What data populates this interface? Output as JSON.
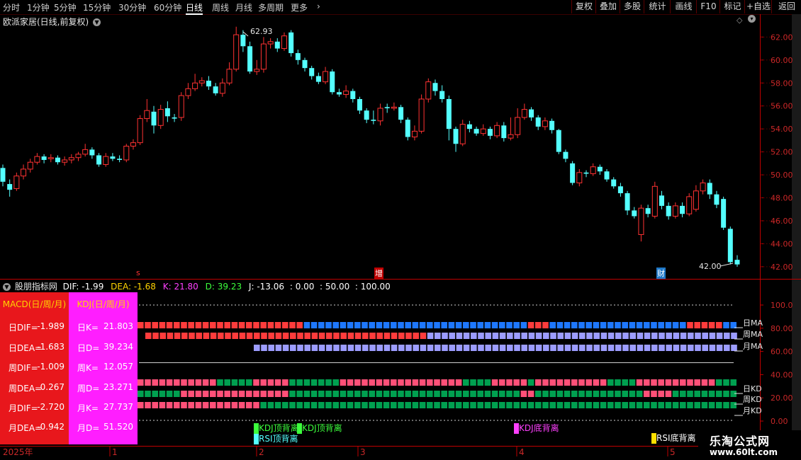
{
  "toolbar": {
    "periods": [
      "分时",
      "1分钟",
      "5分钟",
      "15分钟",
      "30分钟",
      "60分钟",
      "日线",
      "周线",
      "月线",
      "多周期",
      "更多"
    ],
    "active_period": "日线",
    "right_buttons": [
      "复权",
      "叠加",
      "多股",
      "统计",
      "画线",
      "F10",
      "标记",
      "+自选",
      "返回"
    ]
  },
  "chart_title": "欧派家居(日线,前复权)",
  "indicator_header": {
    "name": "股朋指标网",
    "dif_label": "DIF: -1.99",
    "dea_label": "DEA: -1.68",
    "k_label": "K: 21.80",
    "d_label": "D: 39.23",
    "j_label": "J: -13.06",
    "extra_label": ": 0.00  : 50.00  : 100.00"
  },
  "markers": {
    "s": "s",
    "zeng": "增",
    "cai": "财"
  },
  "colors": {
    "up": "#ff3232",
    "down": "#54ffff",
    "blue_block": "#1e78ff",
    "lavender_block": "#9c9cff",
    "green_block": "#00a050",
    "pink_block": "#ff5078",
    "axis": "#c00000"
  },
  "price_panel": {
    "high_label": "62.93",
    "low_label": "42.00",
    "y_ticks": [
      "62.00",
      "60.00",
      "58.00",
      "56.00",
      "54.00",
      "52.00",
      "50.00",
      "48.00",
      "46.00",
      "44.00",
      "42.00"
    ]
  },
  "indicator_panel": {
    "y_ticks": [
      "100.0",
      "80.00",
      "60.00",
      "40.00",
      "20.00",
      "0.00"
    ],
    "macd_row_labels": [
      "日MA",
      "周MA",
      "月MA"
    ],
    "kdj_row_labels": [
      "日KD",
      "周KD",
      "月KD"
    ]
  },
  "signals": {
    "kdj_top_1": "KDJ顶背离",
    "kdj_top_2": "KDJ顶背离",
    "rsi_top": "RSI顶背离",
    "kdj_bottom": "KDJ底背离",
    "rsi_bottom": "RSI底背离"
  },
  "left_panel": {
    "macd_header": "MACD(日/周/月)",
    "kdj_header": "KDJ(日/周/月)",
    "macd_rows": [
      {
        "k": "日DIF=",
        "v": "-1.989"
      },
      {
        "k": "日DEA=",
        "v": "-1.683"
      },
      {
        "k": "周DIF=",
        "v": "-1.009"
      },
      {
        "k": "周DEA=",
        "v": "0.267"
      },
      {
        "k": "月DIF=",
        "v": "-2.720"
      },
      {
        "k": "月DEA=",
        "v": "-0.942"
      }
    ],
    "kdj_rows": [
      {
        "k": "日K=",
        "v": "21.803"
      },
      {
        "k": "日D=",
        "v": "39.234"
      },
      {
        "k": "周K=",
        "v": "12.057"
      },
      {
        "k": "周D=",
        "v": "23.271"
      },
      {
        "k": "月K=",
        "v": "27.737"
      },
      {
        "k": "月D=",
        "v": "51.520"
      }
    ]
  },
  "time_axis": {
    "year_label": "2025年",
    "months": [
      "1",
      "2",
      "3",
      "4",
      "5"
    ]
  },
  "logo": {
    "line1": "乐淘公式网",
    "line2": "www.60lt.com"
  },
  "chart_data": {
    "type": "candlestick",
    "ylim": [
      41.5,
      63.5
    ],
    "candles": [
      {
        "o": 50.6,
        "c": 49.4,
        "h": 50.9,
        "l": 49.0
      },
      {
        "o": 49.2,
        "c": 48.7,
        "h": 49.6,
        "l": 48.1
      },
      {
        "o": 48.8,
        "c": 49.9,
        "h": 50.2,
        "l": 48.6
      },
      {
        "o": 49.9,
        "c": 50.5,
        "h": 50.9,
        "l": 49.6
      },
      {
        "o": 50.5,
        "c": 51.1,
        "h": 51.4,
        "l": 50.2
      },
      {
        "o": 51.1,
        "c": 51.6,
        "h": 51.9,
        "l": 50.9
      },
      {
        "o": 51.6,
        "c": 51.3,
        "h": 51.8,
        "l": 51.0
      },
      {
        "o": 51.4,
        "c": 51.5,
        "h": 51.8,
        "l": 51.1
      },
      {
        "o": 51.5,
        "c": 51.1,
        "h": 51.7,
        "l": 50.9
      },
      {
        "o": 51.1,
        "c": 51.3,
        "h": 51.6,
        "l": 50.8
      },
      {
        "o": 51.3,
        "c": 51.5,
        "h": 51.8,
        "l": 51.0
      },
      {
        "o": 51.5,
        "c": 51.8,
        "h": 52.0,
        "l": 51.2
      },
      {
        "o": 51.8,
        "c": 52.2,
        "h": 52.7,
        "l": 51.6
      },
      {
        "o": 52.2,
        "c": 51.7,
        "h": 52.4,
        "l": 51.4
      },
      {
        "o": 51.7,
        "c": 50.9,
        "h": 51.9,
        "l": 50.7
      },
      {
        "o": 50.9,
        "c": 51.6,
        "h": 51.9,
        "l": 50.7
      },
      {
        "o": 51.6,
        "c": 51.4,
        "h": 51.9,
        "l": 51.2
      },
      {
        "o": 51.4,
        "c": 51.3,
        "h": 51.7,
        "l": 51.1
      },
      {
        "o": 51.3,
        "c": 52.5,
        "h": 52.7,
        "l": 51.1
      },
      {
        "o": 52.5,
        "c": 52.8,
        "h": 53.1,
        "l": 52.2
      },
      {
        "o": 52.8,
        "c": 54.9,
        "h": 55.2,
        "l": 52.6
      },
      {
        "o": 54.9,
        "c": 55.6,
        "h": 56.6,
        "l": 54.6
      },
      {
        "o": 55.5,
        "c": 54.3,
        "h": 56.0,
        "l": 53.6
      },
      {
        "o": 54.3,
        "c": 55.7,
        "h": 56.1,
        "l": 54.0
      },
      {
        "o": 55.8,
        "c": 55.1,
        "h": 56.4,
        "l": 54.6
      },
      {
        "o": 55.0,
        "c": 54.9,
        "h": 55.3,
        "l": 54.6
      },
      {
        "o": 55.0,
        "c": 56.9,
        "h": 57.2,
        "l": 54.7
      },
      {
        "o": 56.9,
        "c": 57.5,
        "h": 58.0,
        "l": 56.6
      },
      {
        "o": 57.5,
        "c": 58.0,
        "h": 58.8,
        "l": 57.3
      },
      {
        "o": 58.0,
        "c": 58.2,
        "h": 58.5,
        "l": 57.7
      },
      {
        "o": 58.2,
        "c": 57.7,
        "h": 58.6,
        "l": 57.4
      },
      {
        "o": 57.7,
        "c": 57.1,
        "h": 58.0,
        "l": 56.9
      },
      {
        "o": 57.1,
        "c": 58.0,
        "h": 58.4,
        "l": 56.8
      },
      {
        "o": 58.0,
        "c": 59.2,
        "h": 59.8,
        "l": 57.8
      },
      {
        "o": 59.2,
        "c": 62.2,
        "h": 62.9,
        "l": 59.0
      },
      {
        "o": 62.2,
        "c": 61.2,
        "h": 62.6,
        "l": 60.7
      },
      {
        "o": 61.2,
        "c": 59.0,
        "h": 61.6,
        "l": 58.8
      },
      {
        "o": 59.0,
        "c": 59.2,
        "h": 60.0,
        "l": 58.7
      },
      {
        "o": 59.2,
        "c": 61.4,
        "h": 62.0,
        "l": 58.9
      },
      {
        "o": 61.4,
        "c": 61.6,
        "h": 61.9,
        "l": 61.0
      },
      {
        "o": 61.6,
        "c": 61.0,
        "h": 61.9,
        "l": 60.7
      },
      {
        "o": 61.0,
        "c": 62.1,
        "h": 62.4,
        "l": 60.8
      },
      {
        "o": 62.4,
        "c": 60.6,
        "h": 62.6,
        "l": 60.3
      },
      {
        "o": 60.6,
        "c": 60.0,
        "h": 60.9,
        "l": 59.6
      },
      {
        "o": 60.0,
        "c": 59.3,
        "h": 60.2,
        "l": 59.0
      },
      {
        "o": 59.3,
        "c": 58.6,
        "h": 59.5,
        "l": 58.3
      },
      {
        "o": 58.6,
        "c": 58.1,
        "h": 58.9,
        "l": 57.9
      },
      {
        "o": 58.1,
        "c": 59.0,
        "h": 59.4,
        "l": 57.9
      },
      {
        "o": 59.0,
        "c": 57.2,
        "h": 59.2,
        "l": 57.0
      },
      {
        "o": 57.2,
        "c": 57.0,
        "h": 57.5,
        "l": 56.8
      },
      {
        "o": 57.0,
        "c": 57.3,
        "h": 57.8,
        "l": 56.7
      },
      {
        "o": 57.3,
        "c": 56.6,
        "h": 57.5,
        "l": 56.3
      },
      {
        "o": 56.6,
        "c": 55.6,
        "h": 56.8,
        "l": 55.3
      },
      {
        "o": 55.6,
        "c": 54.8,
        "h": 55.8,
        "l": 54.5
      },
      {
        "o": 54.8,
        "c": 54.7,
        "h": 55.6,
        "l": 54.4
      },
      {
        "o": 54.7,
        "c": 55.8,
        "h": 56.2,
        "l": 54.3
      },
      {
        "o": 55.9,
        "c": 55.8,
        "h": 56.2,
        "l": 55.4
      },
      {
        "o": 55.8,
        "c": 55.9,
        "h": 56.3,
        "l": 55.6
      },
      {
        "o": 55.9,
        "c": 54.8,
        "h": 56.1,
        "l": 54.5
      },
      {
        "o": 54.8,
        "c": 53.3,
        "h": 55.0,
        "l": 53.0
      },
      {
        "o": 53.3,
        "c": 53.8,
        "h": 54.3,
        "l": 53.0
      },
      {
        "o": 53.8,
        "c": 56.6,
        "h": 57.0,
        "l": 53.6
      },
      {
        "o": 56.6,
        "c": 58.1,
        "h": 58.4,
        "l": 56.3
      },
      {
        "o": 58.0,
        "c": 57.3,
        "h": 58.3,
        "l": 56.9
      },
      {
        "o": 57.3,
        "c": 56.6,
        "h": 57.8,
        "l": 56.3
      },
      {
        "o": 56.6,
        "c": 54.0,
        "h": 56.9,
        "l": 53.0
      },
      {
        "o": 54.0,
        "c": 52.7,
        "h": 54.2,
        "l": 52.0
      },
      {
        "o": 52.7,
        "c": 54.4,
        "h": 54.8,
        "l": 52.5
      },
      {
        "o": 54.4,
        "c": 54.0,
        "h": 54.7,
        "l": 53.7
      },
      {
        "o": 54.0,
        "c": 53.6,
        "h": 54.2,
        "l": 53.4
      },
      {
        "o": 53.6,
        "c": 54.0,
        "h": 54.4,
        "l": 53.4
      },
      {
        "o": 54.0,
        "c": 53.4,
        "h": 54.2,
        "l": 53.1
      },
      {
        "o": 53.4,
        "c": 54.3,
        "h": 54.6,
        "l": 53.2
      },
      {
        "o": 54.3,
        "c": 53.2,
        "h": 54.6,
        "l": 52.9
      },
      {
        "o": 53.2,
        "c": 53.5,
        "h": 55.0,
        "l": 53.0
      },
      {
        "o": 53.5,
        "c": 55.0,
        "h": 55.8,
        "l": 53.2
      },
      {
        "o": 55.0,
        "c": 55.7,
        "h": 56.2,
        "l": 54.8
      },
      {
        "o": 55.7,
        "c": 55.0,
        "h": 55.9,
        "l": 54.7
      },
      {
        "o": 55.0,
        "c": 54.2,
        "h": 55.2,
        "l": 53.9
      },
      {
        "o": 54.2,
        "c": 54.7,
        "h": 55.0,
        "l": 53.9
      },
      {
        "o": 54.7,
        "c": 53.9,
        "h": 54.9,
        "l": 53.6
      },
      {
        "o": 53.9,
        "c": 52.0,
        "h": 54.0,
        "l": 51.8
      },
      {
        "o": 52.0,
        "c": 51.4,
        "h": 52.2,
        "l": 51.1
      },
      {
        "o": 51.0,
        "c": 49.3,
        "h": 51.2,
        "l": 49.1
      },
      {
        "o": 49.3,
        "c": 50.2,
        "h": 50.5,
        "l": 49.0
      },
      {
        "o": 50.2,
        "c": 50.1,
        "h": 50.4,
        "l": 49.8
      },
      {
        "o": 50.1,
        "c": 50.7,
        "h": 51.0,
        "l": 49.9
      },
      {
        "o": 50.7,
        "c": 50.3,
        "h": 50.9,
        "l": 50.0
      },
      {
        "o": 50.3,
        "c": 49.6,
        "h": 50.5,
        "l": 49.4
      },
      {
        "o": 49.6,
        "c": 49.0,
        "h": 49.8,
        "l": 48.8
      },
      {
        "o": 49.0,
        "c": 48.4,
        "h": 49.3,
        "l": 48.1
      },
      {
        "o": 48.4,
        "c": 46.9,
        "h": 48.6,
        "l": 46.5
      },
      {
        "o": 46.9,
        "c": 46.4,
        "h": 47.2,
        "l": 46.2
      },
      {
        "o": 44.8,
        "c": 47.1,
        "h": 47.4,
        "l": 44.2
      },
      {
        "o": 47.1,
        "c": 46.6,
        "h": 47.4,
        "l": 46.3
      },
      {
        "o": 46.4,
        "c": 49.0,
        "h": 49.4,
        "l": 46.2
      },
      {
        "o": 48.2,
        "c": 47.3,
        "h": 48.6,
        "l": 47.0
      },
      {
        "o": 47.3,
        "c": 46.4,
        "h": 47.6,
        "l": 46.1
      },
      {
        "o": 46.4,
        "c": 47.3,
        "h": 47.6,
        "l": 46.2
      },
      {
        "o": 47.3,
        "c": 46.6,
        "h": 47.6,
        "l": 46.3
      },
      {
        "o": 46.6,
        "c": 48.1,
        "h": 48.4,
        "l": 46.4
      },
      {
        "o": 47.0,
        "c": 48.6,
        "h": 49.1,
        "l": 46.8
      },
      {
        "o": 48.6,
        "c": 49.3,
        "h": 49.6,
        "l": 48.3
      },
      {
        "o": 49.3,
        "c": 48.3,
        "h": 49.6,
        "l": 47.9
      },
      {
        "o": 48.3,
        "c": 47.4,
        "h": 48.6,
        "l": 47.1
      },
      {
        "o": 47.9,
        "c": 45.4,
        "h": 48.1,
        "l": 45.2
      },
      {
        "o": 45.3,
        "c": 42.4,
        "h": 45.5,
        "l": 42.2
      },
      {
        "o": 42.6,
        "c": 42.2,
        "h": 43.0,
        "l": 42.0
      }
    ]
  }
}
